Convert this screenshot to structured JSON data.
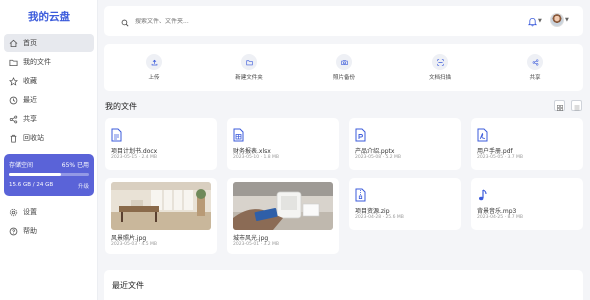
{
  "app": {
    "logo": "我的云盘"
  },
  "sidebar": {
    "items": [
      {
        "label": "首页",
        "icon": "home-icon",
        "active": true
      },
      {
        "label": "我的文件",
        "icon": "folder-icon"
      },
      {
        "label": "收藏",
        "icon": "star-icon"
      },
      {
        "label": "最近",
        "icon": "clock-icon"
      },
      {
        "label": "共享",
        "icon": "share-icon"
      },
      {
        "label": "回收站",
        "icon": "trash-icon"
      }
    ],
    "storage": {
      "label": "存储空间",
      "percent_text": "65% 已用",
      "used_fraction": 0.65,
      "used_text": "15.6 GB / 24 GB",
      "upgrade": "升级"
    },
    "bottom_items": [
      {
        "label": "设置",
        "icon": "gear-icon"
      },
      {
        "label": "帮助",
        "icon": "help-icon"
      }
    ]
  },
  "header": {
    "search_placeholder": "搜索文件、文件夹..."
  },
  "quick_actions": [
    {
      "label": "上传",
      "icon": "upload-icon"
    },
    {
      "label": "新建文件夹",
      "icon": "folder-plus-icon"
    },
    {
      "label": "照片备份",
      "icon": "camera-icon"
    },
    {
      "label": "文档扫描",
      "icon": "scan-icon"
    },
    {
      "label": "共享",
      "icon": "share-icon"
    }
  ],
  "files_section": {
    "title": "我的文件"
  },
  "files": [
    {
      "name": "项目计划书.docx",
      "meta": "2023-05-15 · 2.4 MB",
      "kind": "docx"
    },
    {
      "name": "财务报表.xlsx",
      "meta": "2023-05-10 · 1.8 MB",
      "kind": "xlsx"
    },
    {
      "name": "产品介绍.pptx",
      "meta": "2023-05-08 · 5.2 MB",
      "kind": "pptx"
    },
    {
      "name": "用户手册.pdf",
      "meta": "2023-05-05 · 3.7 MB",
      "kind": "pdf"
    },
    {
      "name": "风景照片.jpg",
      "meta": "2023-05-03 · 4.5 MB",
      "kind": "image"
    },
    {
      "name": "城市风光.jpg",
      "meta": "2023-05-01 · 3.2 MB",
      "kind": "image"
    },
    {
      "name": "项目资源.zip",
      "meta": "2023-04-28 · 25.6 MB",
      "kind": "zip"
    },
    {
      "name": "背景音乐.mp3",
      "meta": "2023-04-25 · 8.7 MB",
      "kind": "mp3"
    }
  ],
  "recent_section": {
    "title": "最近文件"
  },
  "colors": {
    "accent": "#3b5bdb",
    "storage_bg": "#5a63d8",
    "page_bg": "#f4f5f8"
  }
}
